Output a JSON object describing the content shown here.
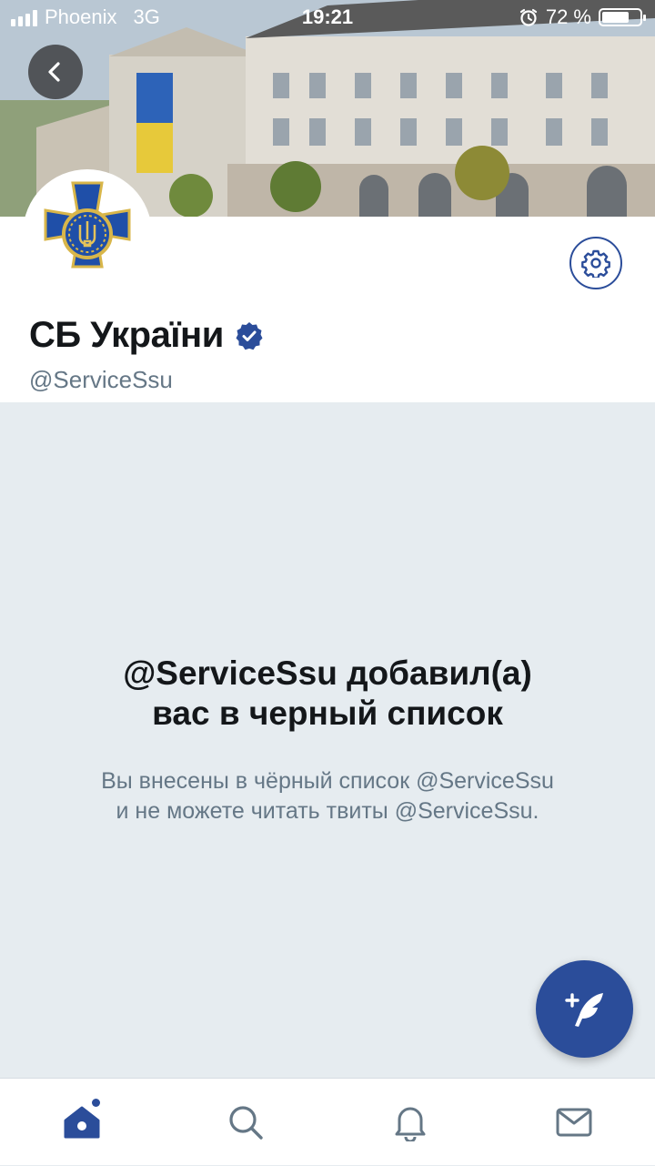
{
  "status_bar": {
    "carrier": "Phoenix",
    "network": "3G",
    "time": "19:21",
    "battery_percent": "72 %",
    "battery_level": 0.72
  },
  "profile": {
    "display_name": "СБ України",
    "handle": "@ServiceSsu",
    "verified": true
  },
  "blocked": {
    "title_line1": "@ServiceSsu добавил(а)",
    "title_line2": "вас в черный список",
    "desc_line1": "Вы внесены в чёрный список @ServiceSsu",
    "desc_line2": "и не можете читать твиты @ServiceSsu."
  },
  "colors": {
    "accent": "#2b4d9a",
    "background": "#e6ecf0",
    "text_primary": "#14171a",
    "text_secondary": "#657786"
  },
  "nav": {
    "items": [
      {
        "icon": "home-icon",
        "active": true,
        "has_notification_dot": true
      },
      {
        "icon": "search-icon",
        "active": false
      },
      {
        "icon": "bell-icon",
        "active": false
      },
      {
        "icon": "mail-icon",
        "active": false
      }
    ]
  },
  "icons": {
    "back": "chevron-left-icon",
    "settings": "gear-icon",
    "verified": "verified-badge-icon",
    "compose": "compose-tweet-icon"
  }
}
